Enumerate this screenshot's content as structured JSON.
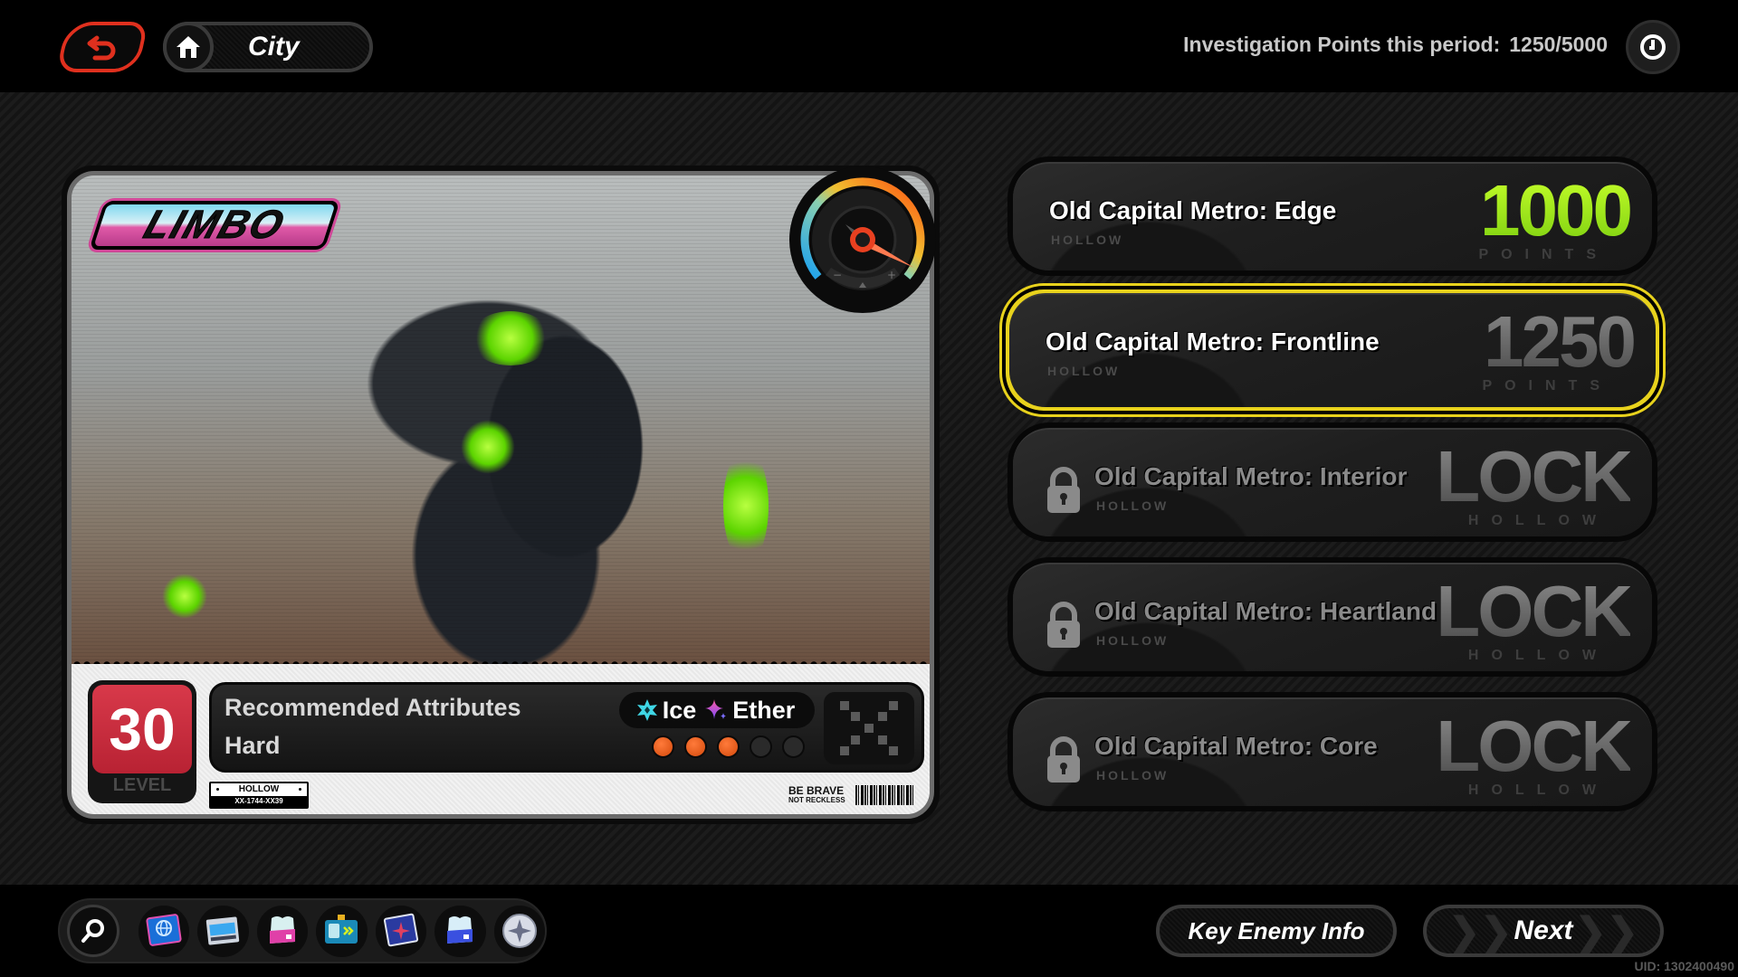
{
  "header": {
    "location_label": "City",
    "investigation_label": "Investigation Points this period:",
    "investigation_value": "1250/5000"
  },
  "card": {
    "enemy_logo": "LIMBO",
    "level_value": "30",
    "level_label": "LEVEL",
    "attributes_title": "Recommended Attributes",
    "difficulty": "Hard",
    "elements": [
      {
        "name": "Ice",
        "icon": "ice-star-icon",
        "color": "#3fd7e6"
      },
      {
        "name": "Ether",
        "icon": "ether-sparkle-icon",
        "color": "#d050e0"
      }
    ],
    "difficulty_rating": {
      "filled": 3,
      "total": 5,
      "filled_color": "#e8561a"
    },
    "plate_top": "HOLLOW",
    "plate_bottom": "XX-1744-XX39",
    "slogan_line1": "BE BRAVE",
    "slogan_line2": "NOT RECKLESS"
  },
  "stages": [
    {
      "name": "Old Capital Metro: Edge",
      "sub": "HOLLOW",
      "value": "1000",
      "unit": "POINTS",
      "state": "completed"
    },
    {
      "name": "Old Capital Metro: Frontline",
      "sub": "HOLLOW",
      "value": "1250",
      "unit": "POINTS",
      "state": "selected"
    },
    {
      "name": "Old Capital Metro: Interior",
      "sub": "HOLLOW",
      "value": "LOCK",
      "unit": "HOLLOW",
      "state": "locked"
    },
    {
      "name": "Old Capital Metro: Heartland",
      "sub": "HOLLOW",
      "value": "LOCK",
      "unit": "HOLLOW",
      "state": "locked"
    },
    {
      "name": "Old Capital Metro: Core",
      "sub": "HOLLOW",
      "value": "LOCK",
      "unit": "HOLLOW",
      "state": "locked"
    }
  ],
  "toolbar": {
    "items": [
      {
        "icon": "search-icon"
      },
      {
        "icon": "globe-card-icon"
      },
      {
        "icon": "film-card-icon"
      },
      {
        "icon": "pink-pass-icon"
      },
      {
        "icon": "id-card-icon"
      },
      {
        "icon": "map-card-icon"
      },
      {
        "icon": "blue-pass-icon"
      },
      {
        "icon": "medal-icon"
      }
    ]
  },
  "actions": {
    "key_enemy_label": "Key Enemy Info",
    "next_label": "Next"
  },
  "footer": {
    "uid": "UID: 1302400490"
  },
  "colors": {
    "accent_back": "#e0301e",
    "selected_border": "#e8d21c",
    "points_green": "#9de21a",
    "level_red": "#c92c3c"
  }
}
